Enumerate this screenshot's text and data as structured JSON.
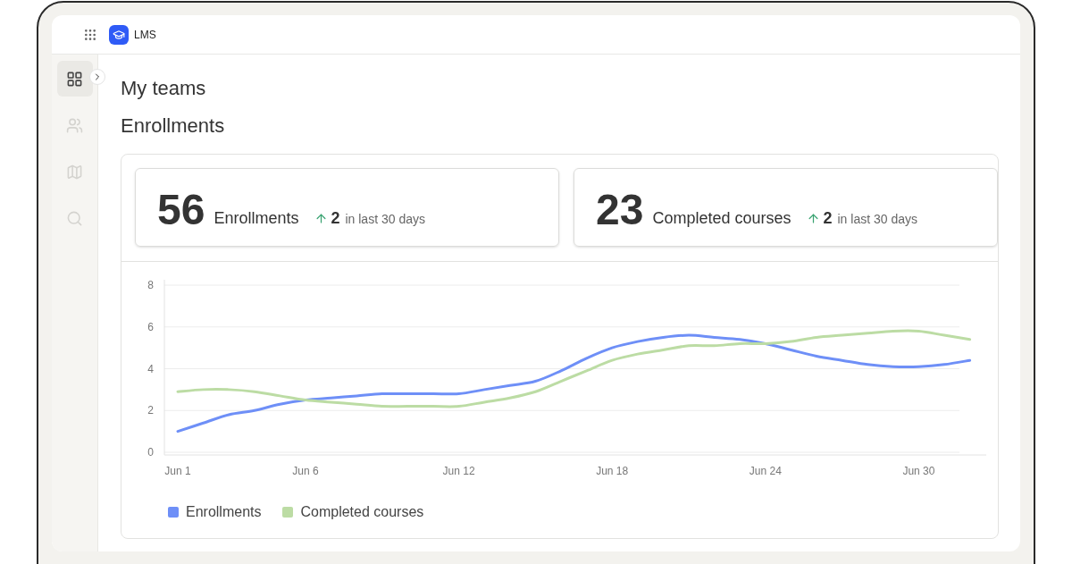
{
  "header": {
    "app_name": "LMS"
  },
  "sidebar": {
    "items": [
      {
        "kind": "dashboard",
        "selected": true
      },
      {
        "kind": "people",
        "selected": false
      },
      {
        "kind": "map",
        "selected": false
      },
      {
        "kind": "search",
        "selected": false
      }
    ]
  },
  "page": {
    "title": "My teams",
    "section_title": "Enrollments"
  },
  "stats": [
    {
      "value": "56",
      "label": "Enrollments",
      "change": "2",
      "period": "in last 30 days"
    },
    {
      "value": "23",
      "label": "Completed courses",
      "change": "2",
      "period": "in last 30 days"
    }
  ],
  "chart_data": {
    "type": "line",
    "grid": true,
    "ylim": [
      0,
      8
    ],
    "yticks": [
      0,
      2,
      4,
      6,
      8
    ],
    "categories": [
      "Jun 1",
      null,
      null,
      null,
      null,
      "Jun 6",
      null,
      null,
      null,
      null,
      null,
      "Jun 12",
      null,
      null,
      null,
      null,
      null,
      "Jun 18",
      null,
      null,
      null,
      null,
      null,
      "Jun 24",
      null,
      null,
      null,
      null,
      null,
      "Jun 30",
      null,
      null
    ],
    "series": [
      {
        "name": "Enrollments",
        "color": "#6e8ff7",
        "values": [
          1.0,
          1.4,
          1.8,
          2.0,
          2.3,
          2.5,
          2.6,
          2.7,
          2.8,
          2.8,
          2.8,
          2.8,
          3.0,
          3.2,
          3.4,
          3.9,
          4.5,
          5.0,
          5.3,
          5.5,
          5.6,
          5.5,
          5.4,
          5.2,
          4.9,
          4.6,
          4.4,
          4.2,
          4.1,
          4.1,
          4.2,
          4.4
        ]
      },
      {
        "name": "Completed courses",
        "color": "#bcdca4",
        "values": [
          2.9,
          3.0,
          3.0,
          2.9,
          2.7,
          2.5,
          2.4,
          2.3,
          2.2,
          2.2,
          2.2,
          2.2,
          2.4,
          2.6,
          2.9,
          3.4,
          3.9,
          4.4,
          4.7,
          4.9,
          5.1,
          5.1,
          5.2,
          5.2,
          5.3,
          5.5,
          5.6,
          5.7,
          5.8,
          5.8,
          5.6,
          5.4
        ]
      }
    ]
  }
}
